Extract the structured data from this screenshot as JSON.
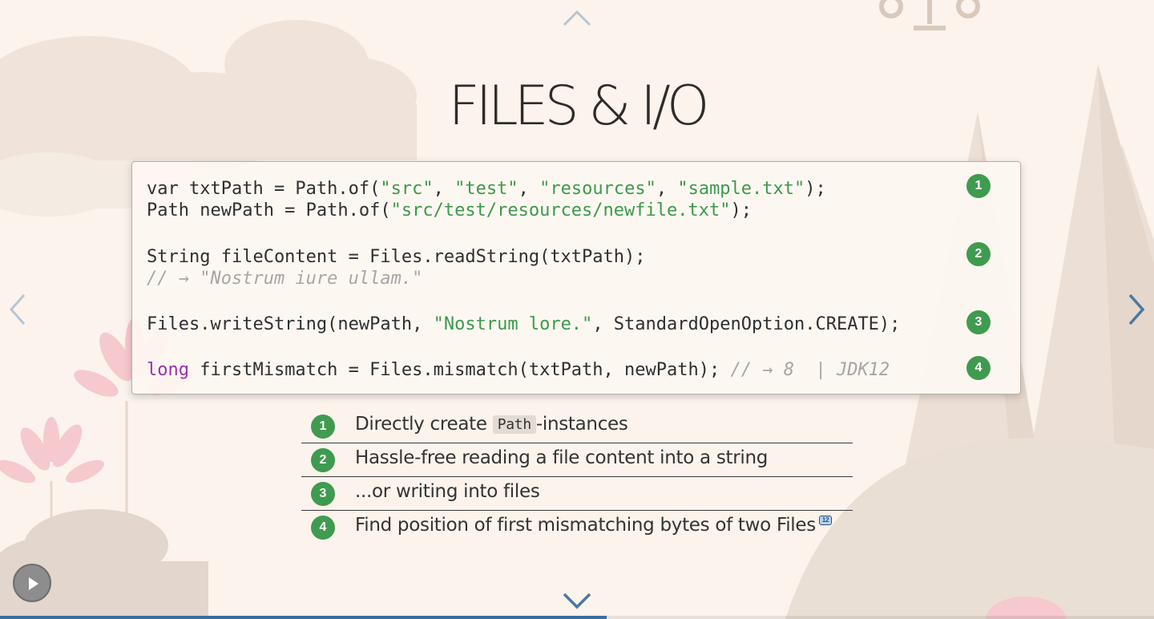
{
  "slide": {
    "title": "FILES & I/O"
  },
  "code": {
    "lines": [
      {
        "t1": "var txtPath = Path.of(",
        "s1": "\"src\"",
        "t2": ", ",
        "s2": "\"test\"",
        "t3": ", ",
        "s3": "\"resources\"",
        "t4": ", ",
        "s4": "\"sample.txt\"",
        "t5": ");"
      },
      {
        "t1": "Path newPath = Path.of(",
        "s1": "\"src/test/resources/newfile.txt\"",
        "t2": ");"
      },
      {
        "t1": "String fileContent = Files.readString(txtPath);"
      },
      {
        "c1": "// → \"Nostrum iure ullam.\""
      },
      {
        "t1": "Files.writeString(newPath, ",
        "s1": "\"Nostrum lore.\"",
        "t2": ", StandardOpenOption.CREATE);"
      },
      {
        "k1": "long",
        "t1": " firstMismatch = Files.mismatch(txtPath, newPath); ",
        "c1": "// → 8  | JDK12"
      }
    ],
    "callouts": [
      "1",
      "2",
      "3",
      "4"
    ]
  },
  "legend": {
    "items": [
      {
        "num": "1",
        "pre": "Directly create ",
        "code": "Path",
        "post": "-instances"
      },
      {
        "num": "2",
        "text": "Hassle-free reading a file content into a string"
      },
      {
        "num": "3",
        "text": "...or writing into files"
      },
      {
        "num": "4",
        "text": "Find position of first mismatching bytes of two Files",
        "tag": "12"
      }
    ]
  },
  "nav": {
    "up": "chevron-up-icon",
    "down": "chevron-down-icon",
    "left": "chevron-left-icon",
    "right": "chevron-right-icon"
  },
  "progress": {
    "fraction": 0.526,
    "color": "#3b6e9e"
  },
  "colors": {
    "badge": "#3f9b50",
    "string": "#3b9a4a",
    "keyword": "#9b30b0",
    "comment": "#a6a6a6",
    "nav_active": "#4a78a4",
    "nav_inactive": "#b8c5d0"
  }
}
